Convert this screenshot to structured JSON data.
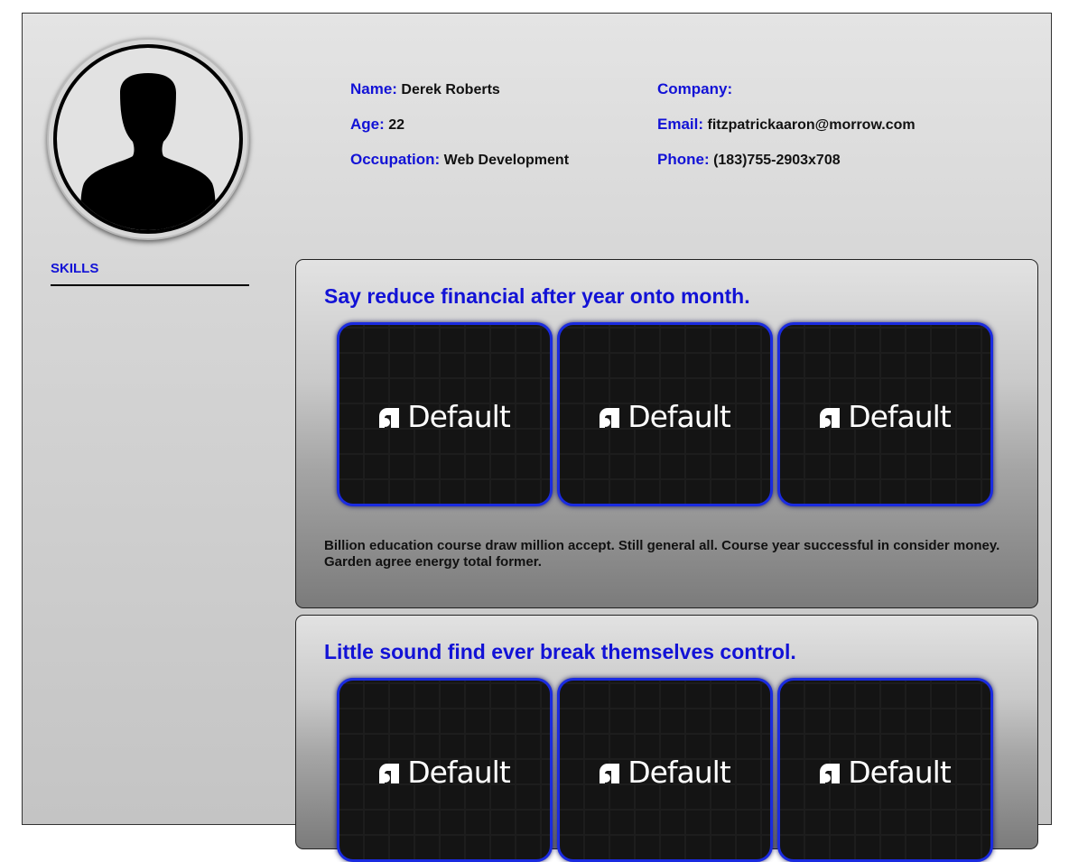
{
  "profile": {
    "name_label": "Name:",
    "name": "Derek Roberts",
    "age_label": "Age:",
    "age": "22",
    "occupation_label": "Occupation:",
    "occupation": "Web Development",
    "company_label": "Company:",
    "company": "",
    "email_label": "Email:",
    "email": "fitzpatrickaaron@morrow.com",
    "phone_label": "Phone:",
    "phone": "(183)755-2903x708"
  },
  "skills": {
    "label": "SKILLS"
  },
  "cards": [
    {
      "title": "Say reduce financial after year onto month.",
      "tiles": [
        "Default",
        "Default",
        "Default"
      ],
      "description": "Billion education course draw million accept. Still general all. Course year successful in consider money. Garden agree energy total former."
    },
    {
      "title": "Little sound find ever break themselves control.",
      "tiles": [
        "Default",
        "Default",
        "Default"
      ]
    }
  ],
  "colors": {
    "accent": "#1212d6",
    "tile_border": "#1a2be0",
    "tile_bg": "#141414"
  },
  "icons": {
    "avatar": "person-silhouette-icon",
    "tile_logo": "default-logo-icon"
  }
}
